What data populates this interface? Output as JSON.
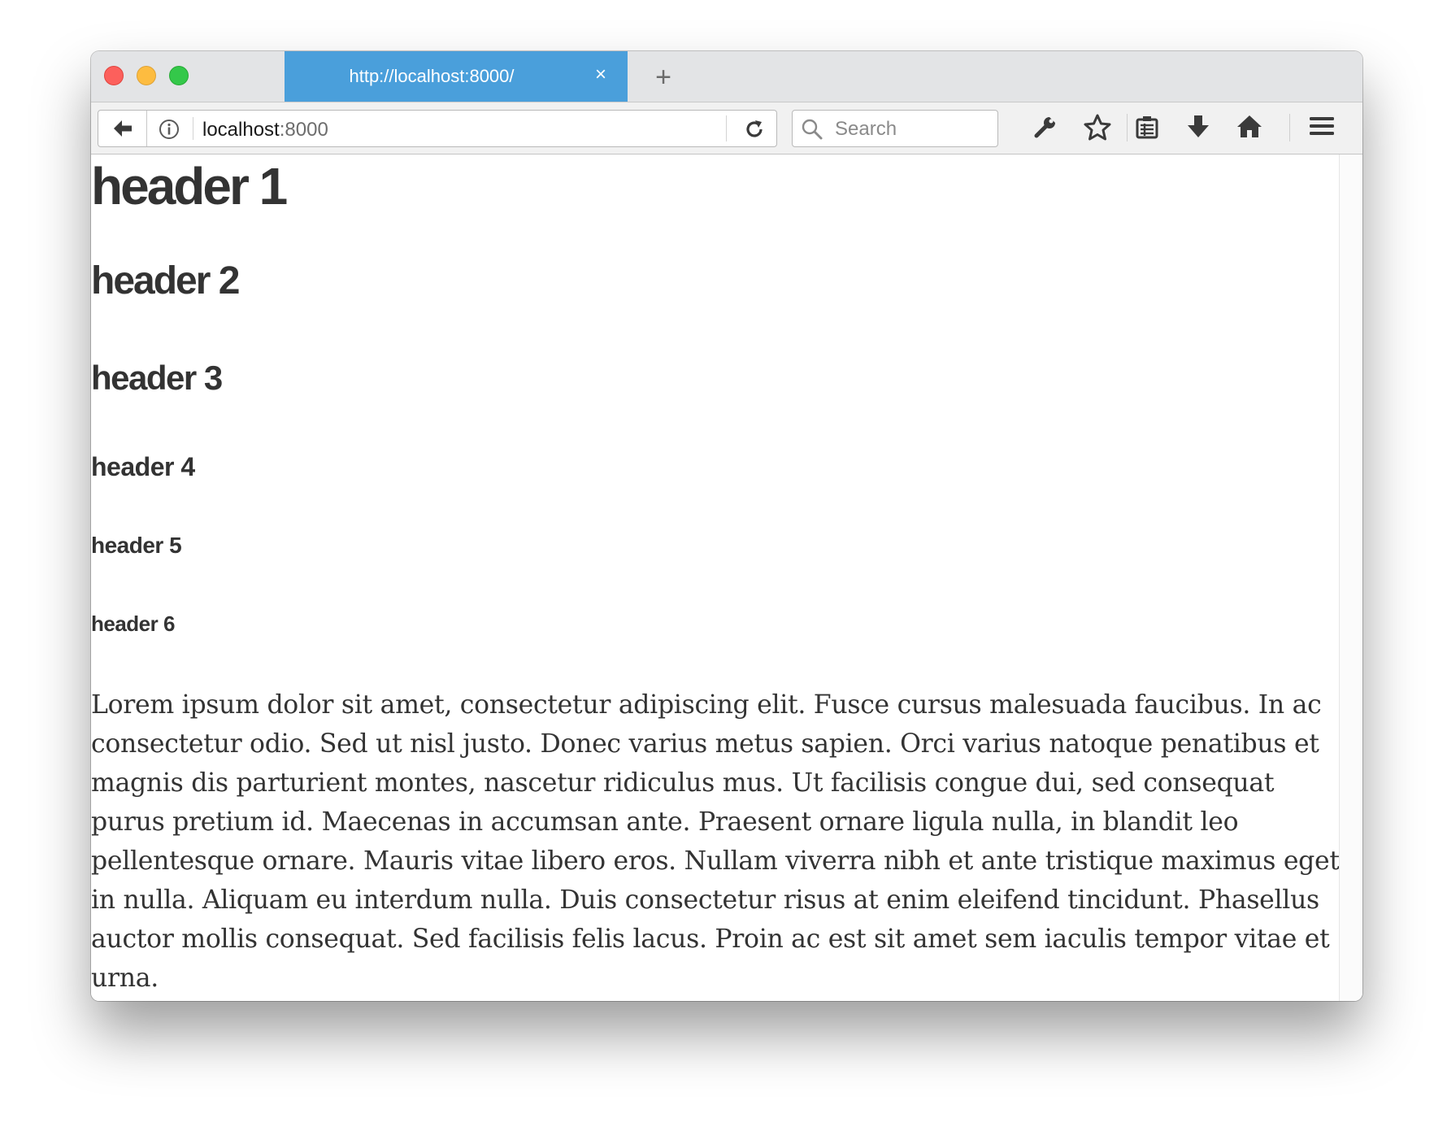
{
  "browser": {
    "tab": {
      "title": "http://localhost:8000/",
      "close_glyph": "×"
    },
    "new_tab_glyph": "+",
    "url": {
      "host": "localhost",
      "port": ":8000"
    },
    "search": {
      "placeholder": "Search"
    },
    "accent_color": "#4a9fdb",
    "toolbar_icons": [
      "back-arrow-icon",
      "info-icon",
      "reload-icon",
      "search-icon",
      "wrench-icon",
      "star-icon",
      "reading-list-icon",
      "download-icon",
      "home-icon",
      "menu-icon"
    ]
  },
  "page": {
    "headers": {
      "h1": "header 1",
      "h2": "header 2",
      "h3": "header 3",
      "h4": "header 4",
      "h5": "header 5",
      "h6": "header 6"
    },
    "paragraph": "Lorem ipsum dolor sit amet, consectetur adipiscing elit. Fusce cursus malesuada faucibus. In ac consectetur odio. Sed ut nisl justo. Donec varius metus sapien. Orci varius natoque penatibus et magnis dis parturient montes, nascetur ridiculus mus. Ut facilisis congue dui, sed consequat purus pretium id. Maecenas in accumsan ante. Praesent ornare ligula nulla, in blandit leo pellentesque ornare. Mauris vitae libero eros. Nullam viverra nibh et ante tristique maximus eget in nulla. Aliquam eu interdum nulla. Duis consectetur risus at enim eleifend tincidunt. Phasellus auctor mollis consequat. Sed facilisis felis lacus. Proin ac est sit amet sem iaculis tempor vitae et urna."
  }
}
